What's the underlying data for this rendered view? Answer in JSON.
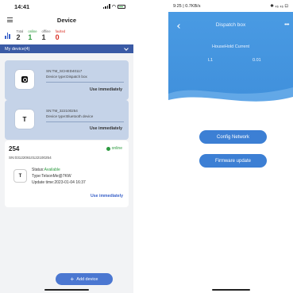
{
  "left": {
    "status": {
      "time": "14:41"
    },
    "header": {
      "title": "Device"
    },
    "stats": {
      "total_label": "Total",
      "total": "2",
      "online_label": "online",
      "online": "1",
      "offline_label": "offline",
      "offline": "1",
      "faulted_label": "faulted",
      "faulted": "0"
    },
    "devices_bar": {
      "label": "My device(4)"
    },
    "cards": [
      {
        "sn": "SN:TM_SCHED40117",
        "type": "Device type:Dispatch box",
        "action": "Use immediately"
      },
      {
        "sn": "SN:TM_322100254",
        "type": "Device type:Bluetooth device",
        "action": "Use immediately"
      }
    ],
    "detail": {
      "number": "254",
      "status": "online",
      "sn": "SN:031220610122100254",
      "status_label": "Status:",
      "status_value": "Available",
      "type": "Type:TelsonMe@7KW",
      "update": "Update time:2023-01-04 16:37",
      "action": "Use immediately"
    },
    "add_button": "Add device"
  },
  "right": {
    "status": {
      "left": "9:25 | 0.7KB/s",
      "right": "✱ ₄₆ ₄₆ ⊡"
    },
    "header": {
      "title": "Dispatch box"
    },
    "current_label": "HouseHold Current",
    "l1_label": "L1",
    "l1_value": "0.01",
    "config_button": "Config Network",
    "firmware_button": "Firmware update"
  },
  "colors": {
    "accent": "#4b77d1",
    "online": "#2d9a3f",
    "faulted": "#d93025",
    "card": "#c5d3e8",
    "header_blue": "#3f8fdb"
  }
}
